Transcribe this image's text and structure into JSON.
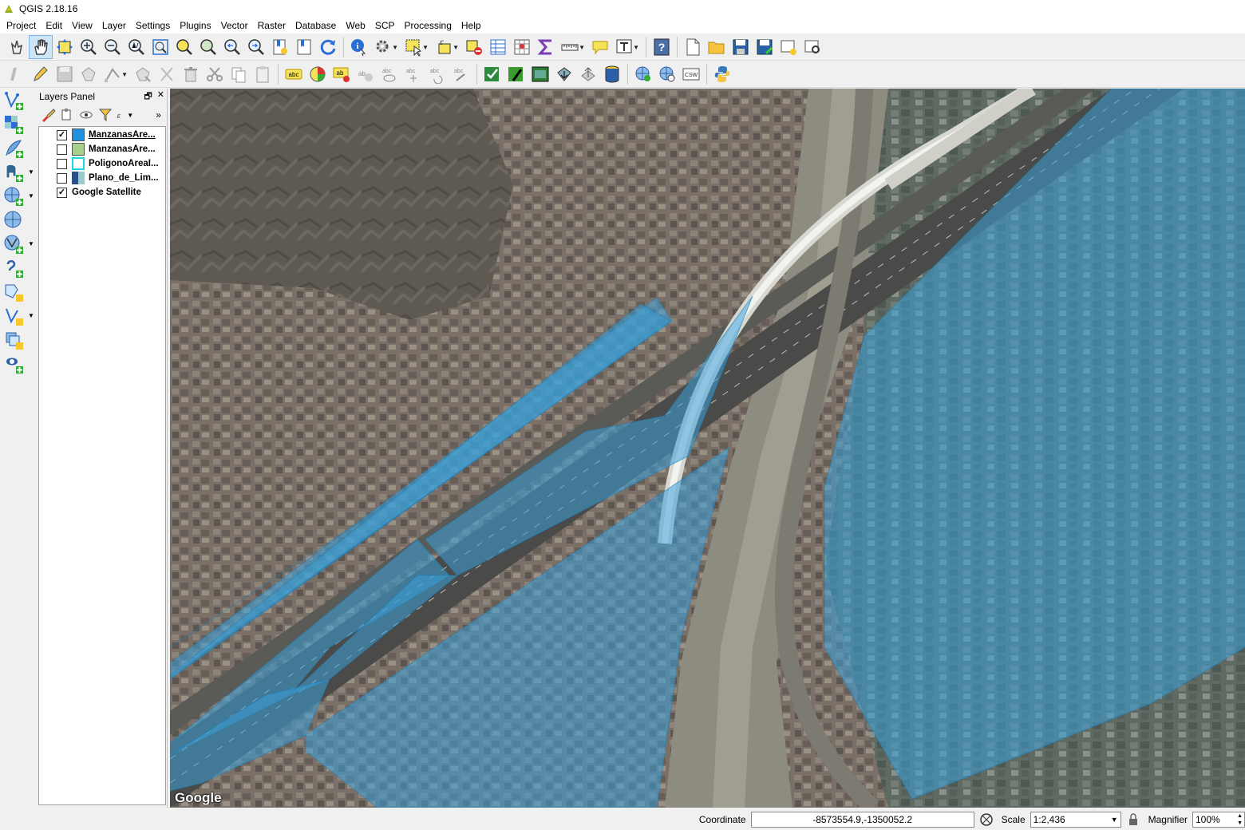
{
  "window": {
    "title": "QGIS 2.18.16"
  },
  "menu": [
    "Project",
    "Edit",
    "View",
    "Layer",
    "Settings",
    "Plugins",
    "Vector",
    "Raster",
    "Database",
    "Web",
    "SCP",
    "Processing",
    "Help"
  ],
  "layers_panel": {
    "title": "Layers Panel",
    "layers": [
      {
        "name": "ManzanasAre...",
        "checked": true,
        "symbol_color": "#1f8fe0",
        "selected": true
      },
      {
        "name": "ManzanasAre...",
        "checked": false,
        "symbol_color": "#a8d08d",
        "selected": false
      },
      {
        "name": "PoligonoAreaI...",
        "checked": false,
        "symbol_color": "#ffffff",
        "selected": false
      },
      {
        "name": "Plano_de_Lim...",
        "checked": false,
        "symbol_color": "raster",
        "selected": false
      },
      {
        "name": "Google Satellite",
        "checked": true,
        "symbol_color": "none",
        "selected": false
      }
    ]
  },
  "map": {
    "watermark": "Google",
    "overlay_color": "#3aa0d8"
  },
  "statusbar": {
    "coordinate_label": "Coordinate",
    "coordinate_value": "-8573554.9,-1350052.2",
    "scale_label": "Scale",
    "scale_value": "1:2,436",
    "magnifier_label": "Magnifier",
    "magnifier_value": "100%"
  }
}
